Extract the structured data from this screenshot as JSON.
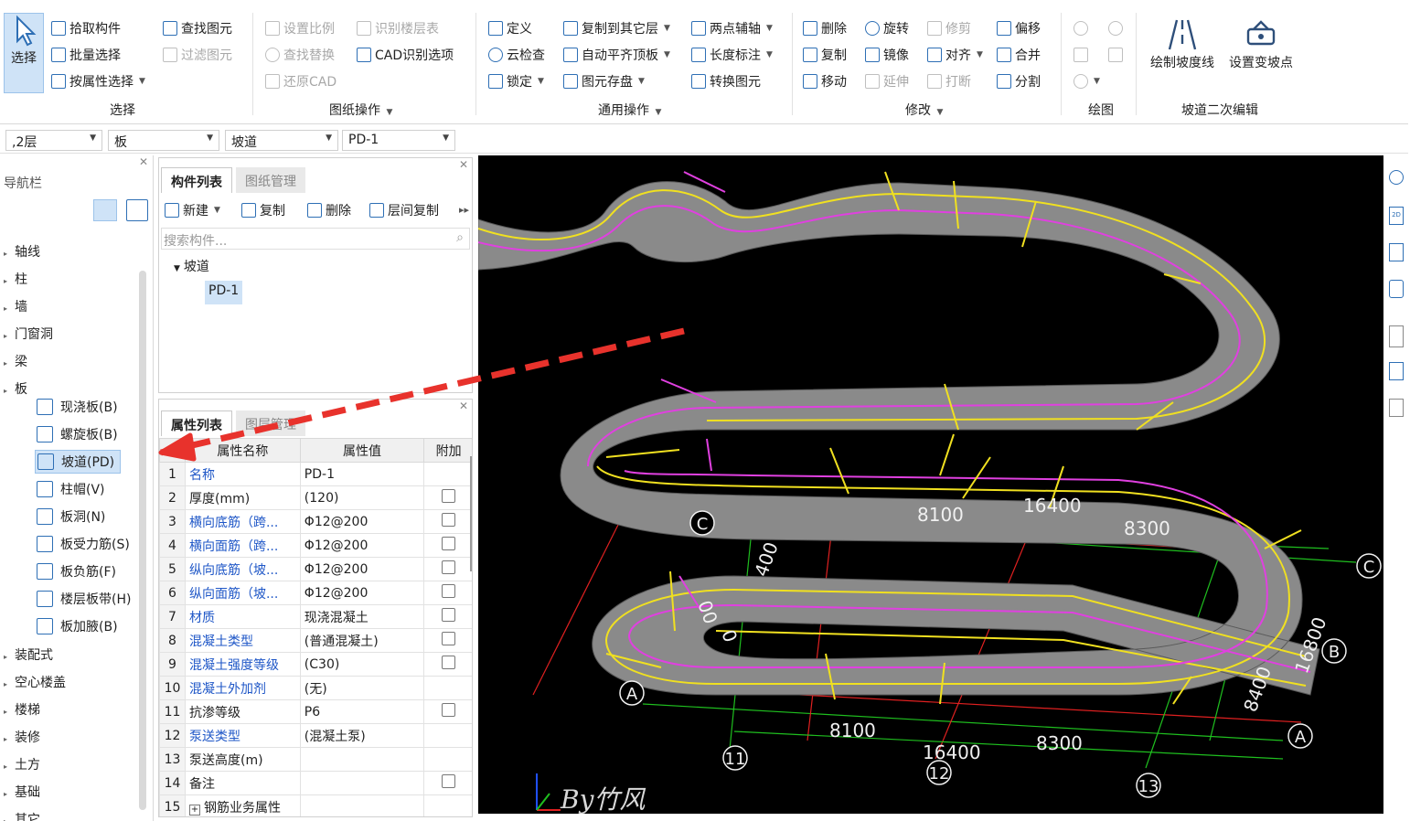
{
  "ribbon": {
    "select_big": "选择",
    "pick_component": "拾取构件",
    "batch_select": "批量选择",
    "select_by_attr": "按属性选择",
    "find_element": "查找图元",
    "filter_element": "过滤图元",
    "group_select": "选择",
    "set_scale": "设置比例",
    "identify_floor_table": "识别楼层表",
    "find_replace": "查找替换",
    "cad_options": "CAD识别选项",
    "restore_cad": "还原CAD",
    "group_drawing": "图纸操作",
    "define": "定义",
    "copy_to_other_layer": "复制到其它层",
    "two_point_axis": "两点辅轴",
    "cloud_check": "云检查",
    "auto_flush_top": "自动平齐顶板",
    "length_dim": "长度标注",
    "lock": "锁定",
    "element_save": "图元存盘",
    "convert_element": "转换图元",
    "group_common": "通用操作",
    "delete": "删除",
    "rotate": "旋转",
    "trim": "修剪",
    "offset": "偏移",
    "copy": "复制",
    "mirror": "镜像",
    "align": "对齐",
    "merge": "合并",
    "move": "移动",
    "extend": "延伸",
    "break": "打断",
    "split": "分割",
    "group_modify": "修改",
    "group_draw": "绘图",
    "draw_slope_line": "绘制坡度线",
    "set_slope_point": "设置变坡点",
    "group_ramp_edit": "坡道二次编辑"
  },
  "selectors": {
    "floor": ",2层",
    "type": "板",
    "sub_type": "坡道",
    "component": "PD-1"
  },
  "nav": {
    "title": "导航栏",
    "items": [
      "轴线",
      "柱",
      "墙",
      "门窗洞",
      "梁",
      "板"
    ],
    "board_children": [
      "现浇板(B)",
      "螺旋板(B)",
      "坡道(PD)",
      "柱帽(V)",
      "板洞(N)",
      "板受力筋(S)",
      "板负筋(F)",
      "楼层板带(H)",
      "板加腋(B)"
    ],
    "items_after": [
      "装配式",
      "空心楼盖",
      "楼梯",
      "装修",
      "土方",
      "基础",
      "其它"
    ]
  },
  "component_list": {
    "tab_active": "构件列表",
    "tab_inactive": "图纸管理",
    "btn_new": "新建",
    "btn_copy": "复制",
    "btn_delete": "删除",
    "btn_layer_copy": "层间复制",
    "search_placeholder": "搜索构件...",
    "tree_root": "坡道",
    "tree_child": "PD-1"
  },
  "property_list": {
    "tab_active": "属性列表",
    "tab_inactive": "图层管理",
    "col_name": "属性名称",
    "col_value": "属性值",
    "col_extra": "附加",
    "rows": [
      {
        "num": "1",
        "name": "名称",
        "value": "PD-1",
        "link": true,
        "check": false
      },
      {
        "num": "2",
        "name": "厚度(mm)",
        "value": "(120)",
        "link": false,
        "check": true
      },
      {
        "num": "3",
        "name": "横向底筋（跨...",
        "value": "Φ12@200",
        "link": true,
        "check": true
      },
      {
        "num": "4",
        "name": "横向面筋（跨...",
        "value": "Φ12@200",
        "link": true,
        "check": true
      },
      {
        "num": "5",
        "name": "纵向底筋（坡...",
        "value": "Φ12@200",
        "link": true,
        "check": true
      },
      {
        "num": "6",
        "name": "纵向面筋（坡...",
        "value": "Φ12@200",
        "link": true,
        "check": true
      },
      {
        "num": "7",
        "name": "材质",
        "value": "现浇混凝土",
        "link": true,
        "check": true
      },
      {
        "num": "8",
        "name": "混凝土类型",
        "value": "(普通混凝土)",
        "link": true,
        "check": true
      },
      {
        "num": "9",
        "name": "混凝土强度等级",
        "value": "(C30)",
        "link": true,
        "check": true
      },
      {
        "num": "10",
        "name": "混凝土外加剂",
        "value": "(无)",
        "link": true,
        "check": false
      },
      {
        "num": "11",
        "name": "抗渗等级",
        "value": "P6",
        "link": false,
        "check": true
      },
      {
        "num": "12",
        "name": "泵送类型",
        "value": "(混凝土泵)",
        "link": true,
        "check": false
      },
      {
        "num": "13",
        "name": "泵送高度(m)",
        "value": "",
        "link": false,
        "check": false
      },
      {
        "num": "14",
        "name": "备注",
        "value": "",
        "link": false,
        "check": true
      },
      {
        "num": "15",
        "name": "钢筋业务属性",
        "value": "",
        "link": false,
        "check": false
      }
    ]
  },
  "viewport": {
    "axis_labels": [
      "A",
      "B",
      "C",
      "11",
      "12",
      "13"
    ],
    "dims_top": [
      "8100",
      "16400",
      "8300"
    ],
    "dims_bottom": [
      "8100",
      "16400",
      "8300"
    ],
    "dims_side": [
      "16800",
      "8400"
    ],
    "dims_inner": [
      "400",
      "00",
      "0"
    ],
    "watermark": "By竹风"
  },
  "colors": {
    "ramp": "#888888",
    "yellow_line": "#f0e020",
    "magenta_line": "#e040e0",
    "axis_green": "#1fbf1f",
    "axis_red": "#e02020",
    "arrow_red": "#e8322c",
    "selection_blue": "#cfe3f7",
    "link_blue": "#1f57c7"
  }
}
